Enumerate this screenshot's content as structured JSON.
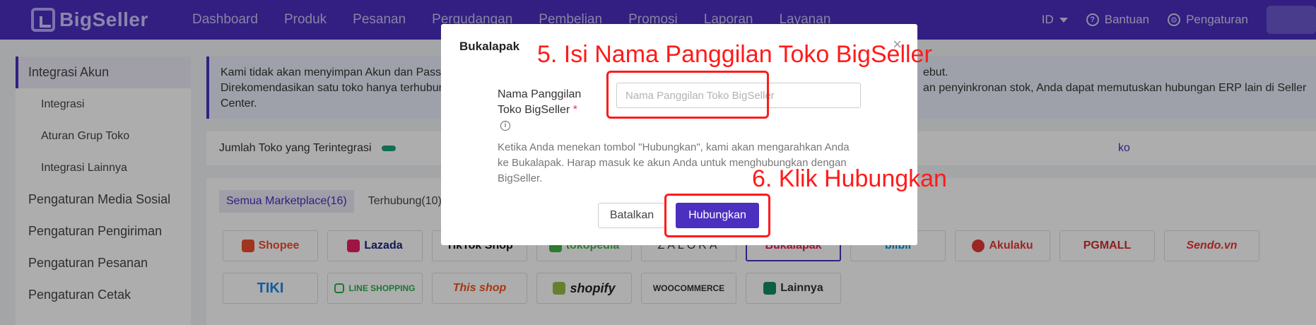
{
  "app": {
    "name": "BigSeller"
  },
  "nav": [
    "Dashboard",
    "Produk",
    "Pesanan",
    "Pergudangan",
    "Pembelian",
    "Promosi",
    "Laporan",
    "Layanan"
  ],
  "topright": {
    "language": "ID",
    "help": "Bantuan",
    "settings": "Pengaturan"
  },
  "sidebar": {
    "section": "Integrasi Akun",
    "subitems": [
      "Integrasi",
      "Aturan Grup Toko",
      "Integrasi Lainnya"
    ],
    "items": [
      "Pengaturan Media Sosial",
      "Pengaturan Pengiriman",
      "Pengaturan Pesanan",
      "Pengaturan Cetak"
    ]
  },
  "notice": {
    "line1": "Kami tidak akan menyimpan Akun dan Passw",
    "line2": "Direkomendasikan satu toko hanya terhubun",
    "line1_right": "ebut.",
    "line2_right": "an penyinkronan stok, Anda dapat memutuskan hubungan ERP lain di Seller",
    "line3": "Center."
  },
  "count": {
    "label": "Jumlah Toko yang Terintegrasi",
    "link_fragment": "ko"
  },
  "market_tabs": [
    "Semua Marketplace(16)",
    "Terhubung(10)"
  ],
  "marketplaces": [
    "Shopee",
    "Lazada",
    "TikTok Shop",
    "tokopedia",
    "ZALORA",
    "Bukalapak",
    "blibli",
    "Akulaku",
    "PGMALL",
    "Sendo.vn",
    "TIKI",
    "LINE SHOPPING",
    "This shop",
    "shopify",
    "WOOCOMMERCE",
    "Lainnya"
  ],
  "modal": {
    "title": "Bukalapak",
    "close": "×",
    "field_label_1": "Nama Panggilan",
    "field_label_2": "Toko BigSeller",
    "required_mark": "*",
    "info_glyph": "i",
    "placeholder": "Nama Panggilan Toko BigSeller",
    "description": "Ketika Anda menekan tombol \"Hubungkan\", kami akan mengarahkan Anda ke Bukalapak. Harap masuk ke akun Anda untuk menghubungkan dengan BigSeller.",
    "cancel": "Batalkan",
    "connect": "Hubungkan"
  },
  "annotations": {
    "step5": "5. Isi Nama Panggilan Toko BigSeller",
    "step6": "6. Klik Hubungkan",
    "color": "#ff1a1a"
  },
  "colors": {
    "brand": "#4b2fbf",
    "progress": "#19a27b"
  }
}
